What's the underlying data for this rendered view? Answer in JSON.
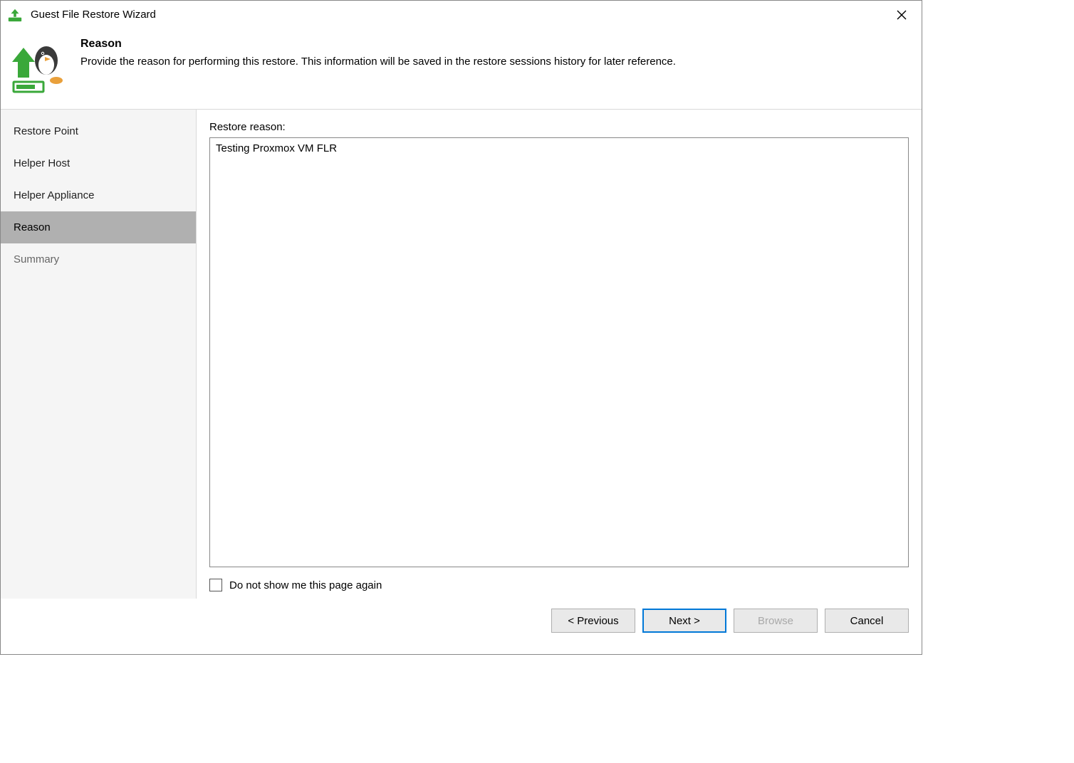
{
  "window": {
    "title": "Guest File Restore Wizard"
  },
  "header": {
    "heading": "Reason",
    "subtext": "Provide the reason for performing this restore. This information will be saved in the restore sessions history for later reference."
  },
  "sidebar": {
    "items": [
      {
        "label": "Restore Point",
        "selected": false
      },
      {
        "label": "Helper Host",
        "selected": false
      },
      {
        "label": "Helper Appliance",
        "selected": false
      },
      {
        "label": "Reason",
        "selected": true
      },
      {
        "label": "Summary",
        "selected": false,
        "dim": true
      }
    ]
  },
  "main": {
    "field_label": "Restore reason:",
    "reason_value": "Testing Proxmox VM FLR",
    "checkbox_label": "Do not show me this page again",
    "checkbox_checked": false
  },
  "footer": {
    "previous": "< Previous",
    "next": "Next >",
    "browse": "Browse",
    "cancel": "Cancel",
    "browse_disabled": true
  },
  "colors": {
    "accent": "#0078d7",
    "green": "#3aa83a",
    "orange": "#e9a03b"
  }
}
